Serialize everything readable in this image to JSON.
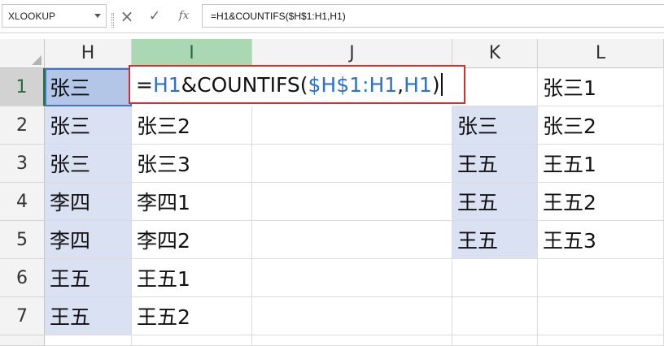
{
  "formula_bar": {
    "name_box": "XLOOKUP",
    "cancel_icon": "×",
    "enter_icon": "✓",
    "fx_icon": "fx",
    "formula_text": "=H1&COUNTIFS($H$1:H1,H1)"
  },
  "columns": [
    "H",
    "I",
    "J",
    "K",
    "L"
  ],
  "rows": [
    "1",
    "2",
    "3",
    "4",
    "5",
    "6",
    "7"
  ],
  "edit_formula": {
    "eq": "=",
    "ref1": "H1",
    "func": "&COUNTIFS(",
    "ref2": "$H$1:H1",
    "comma": ",",
    "ref3": "H1",
    "close": ")"
  },
  "col_H": [
    "张三",
    "张三",
    "张三",
    "李四",
    "李四",
    "王五",
    "王五"
  ],
  "col_I": [
    "",
    "张三2",
    "张三3",
    "李四1",
    "李四2",
    "王五1",
    "王五2"
  ],
  "col_K": [
    "",
    "张三",
    "王五",
    "王五",
    "王五",
    "",
    ""
  ],
  "col_L": [
    "张三1",
    "张三2",
    "王五1",
    "王五2",
    "王五3",
    "",
    ""
  ],
  "colors": {
    "highlight": "#dae1f3",
    "edit_border": "#d32f2f",
    "ref_blue": "#2e6fd0",
    "selected_header": "#a9d8b3"
  }
}
